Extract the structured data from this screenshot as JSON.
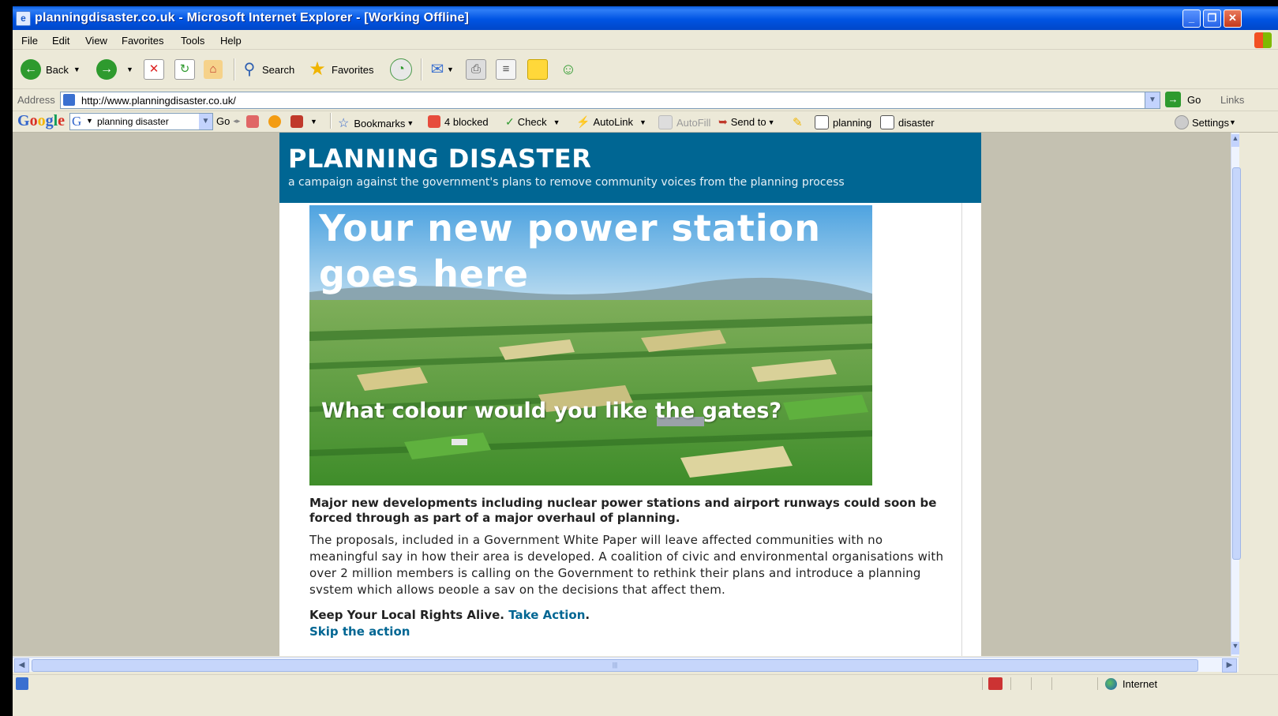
{
  "window": {
    "title": "planningdisaster.co.uk - Microsoft Internet Explorer - [Working Offline]"
  },
  "menu": [
    "File",
    "Edit",
    "View",
    "Favorites",
    "Tools",
    "Help"
  ],
  "toolbar": {
    "back": "Back",
    "search": "Search",
    "favorites": "Favorites"
  },
  "address": {
    "label": "Address",
    "url": "http://www.planningdisaster.co.uk/",
    "go": "Go",
    "links": "Links"
  },
  "google_bar": {
    "logo": "Google",
    "query": "planning disaster",
    "go": "Go",
    "bookmarks": "Bookmarks",
    "popups": "4 blocked",
    "check": "Check",
    "autolink": "AutoLink",
    "autofill": "AutoFill",
    "send_to": "Send to",
    "term1": "planning",
    "term2": "disaster",
    "settings": "Settings"
  },
  "site": {
    "title": "PLANNING DISASTER",
    "subtitle": "a campaign against the government's plans to remove community voices from the planning process",
    "hero_heading": "Your new power station goes here",
    "hero_caption": "What colour would you like the gates?",
    "lead": "Major new developments including nuclear power stations and airport runways could soon be forced through as part of a major overhaul of planning.",
    "body": "The proposals, included in a Government White Paper will leave affected communities with no meaningful say in how their area is developed. A coalition of civic and environmental organisations with over 2 million members is calling on the Government to rethink their plans and introduce a planning system which allows people a say on the decisions that affect them.",
    "action_text": "Keep Your Local Rights Alive.",
    "action_link": "Take Action",
    "action_end": ".",
    "skip_link": "Skip the action"
  },
  "status": {
    "zone": "Internet"
  },
  "colors": {
    "header_blue": "#006693",
    "title_bar": "#0054e3"
  }
}
